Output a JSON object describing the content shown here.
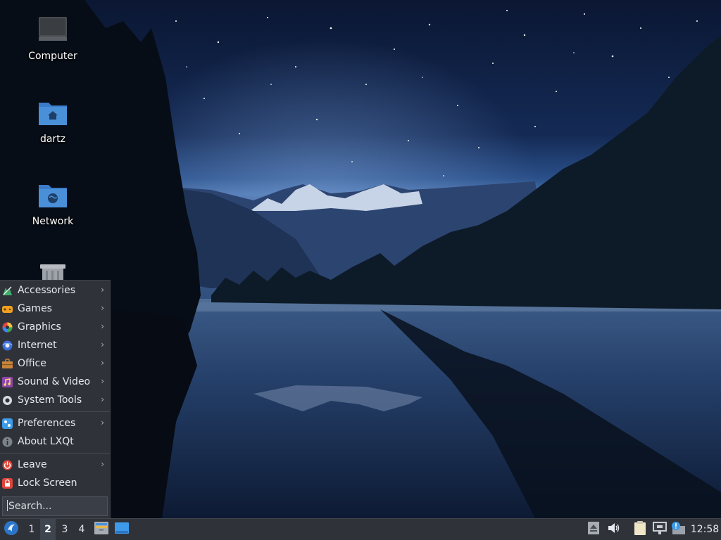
{
  "desktop": {
    "icons": [
      {
        "label": "Computer",
        "icon": "computer-icon"
      },
      {
        "label": "dartz",
        "icon": "home-folder-icon"
      },
      {
        "label": "Network",
        "icon": "network-folder-icon"
      },
      {
        "label": "",
        "icon": "trash-icon"
      }
    ]
  },
  "menu": {
    "categories": [
      {
        "label": "Accessories",
        "icon": "accessories-icon",
        "has_submenu": true
      },
      {
        "label": "Games",
        "icon": "games-icon",
        "has_submenu": true
      },
      {
        "label": "Graphics",
        "icon": "graphics-icon",
        "has_submenu": true
      },
      {
        "label": "Internet",
        "icon": "internet-icon",
        "has_submenu": true
      },
      {
        "label": "Office",
        "icon": "office-icon",
        "has_submenu": true
      },
      {
        "label": "Sound & Video",
        "icon": "sound-video-icon",
        "has_submenu": true
      },
      {
        "label": "System Tools",
        "icon": "system-tools-icon",
        "has_submenu": true
      }
    ],
    "settings": [
      {
        "label": "Preferences",
        "icon": "preferences-icon",
        "has_submenu": true
      },
      {
        "label": "About LXQt",
        "icon": "info-icon",
        "has_submenu": false
      }
    ],
    "session": [
      {
        "label": "Leave",
        "icon": "power-icon",
        "has_submenu": true
      },
      {
        "label": "Lock Screen",
        "icon": "lock-icon",
        "has_submenu": false
      }
    ],
    "search_placeholder": "Search...",
    "arrow": "›"
  },
  "taskbar": {
    "desktops": [
      "1",
      "2",
      "3",
      "4"
    ],
    "active_desktop": "2",
    "clock": "12:58",
    "tray_icons": [
      "eject-icon",
      "volume-icon",
      "clipboard-icon",
      "network-wired-icon",
      "update-notifier-icon"
    ]
  },
  "colors": {
    "panel": "#2f3339",
    "folder": "#4a90d9",
    "accent": "#3d9be9"
  }
}
